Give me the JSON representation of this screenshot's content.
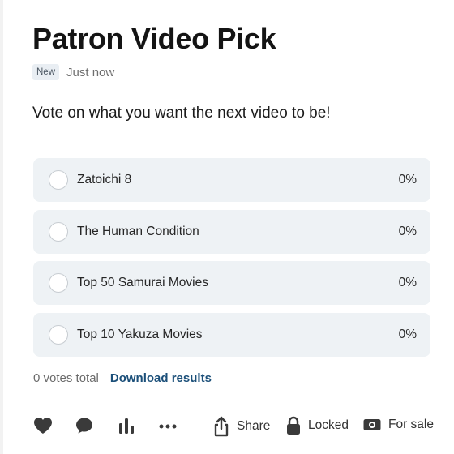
{
  "post": {
    "title": "Patron Video Pick",
    "badge": "New",
    "timestamp": "Just now",
    "prompt": "Vote on what you want the next video to be!"
  },
  "poll": {
    "options": [
      {
        "label": "Zatoichi 8",
        "percent": "0%"
      },
      {
        "label": "The Human Condition",
        "percent": "0%"
      },
      {
        "label": "Top 50 Samurai Movies",
        "percent": "0%"
      },
      {
        "label": "Top 10 Yakuza Movies",
        "percent": "0%"
      }
    ],
    "votes_total": "0 votes total",
    "download_label": "Download results"
  },
  "actions": {
    "share_label": "Share",
    "locked_label": "Locked",
    "sale_label": "For sale",
    "icons": [
      "heart-icon",
      "comment-icon",
      "stats-icon",
      "more-icon",
      "share-icon",
      "lock-icon",
      "money-icon"
    ]
  },
  "colors": {
    "option_bg": "#eef2f5",
    "link": "#1b4f79",
    "icon": "#3a3a3a"
  }
}
